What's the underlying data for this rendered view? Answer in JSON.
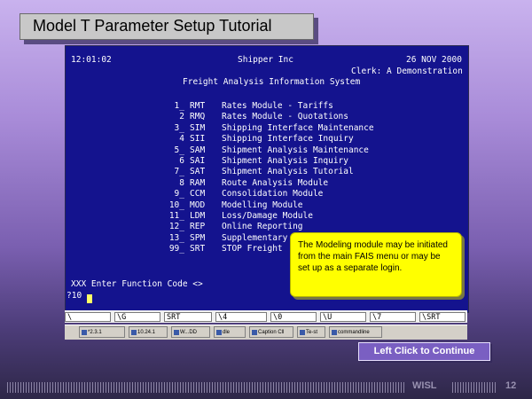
{
  "slide": {
    "title": "Model T Parameter Setup Tutorial",
    "continue_label": "Left Click to Continue",
    "footer_org": "WISL",
    "page_number": "12"
  },
  "terminal": {
    "time": "12:01:02",
    "company": "Shipper Inc",
    "date": "26 NOV 2000",
    "clerk": "Clerk: A Demonstration",
    "system_name": "Freight Analysis Information System",
    "menu": [
      {
        "num": "1_",
        "code": "RMT",
        "desc": "Rates Module - Tariffs"
      },
      {
        "num": "2",
        "code": "RMQ",
        "desc": "Rates Module - Quotations"
      },
      {
        "num": "3_",
        "code": "SIM",
        "desc": "Shipping Interface Maintenance"
      },
      {
        "num": "4",
        "code": "SII",
        "desc": "Shipping Interface Inquiry"
      },
      {
        "num": "5_",
        "code": "SAM",
        "desc": "Shipment Analysis Maintenance"
      },
      {
        "num": "6",
        "code": "SAI",
        "desc": "Shipment Analysis Inquiry"
      },
      {
        "num": "7_",
        "code": "SAT",
        "desc": "Shipment Analysis Tutorial"
      },
      {
        "num": "8",
        "code": "RAM",
        "desc": "Route Analysis Module"
      },
      {
        "num": "9_",
        "code": "CCM",
        "desc": "Consolidation Module"
      },
      {
        "num": "10_",
        "code": "MOD",
        "desc": "Modelling Module"
      },
      {
        "num": "11_",
        "code": "LDM",
        "desc": "Loss/Damage Module"
      },
      {
        "num": "12_",
        "code": "REP",
        "desc": "Online Reporting"
      },
      {
        "num": "13_",
        "code": "SPM",
        "desc": "Supplementary"
      },
      {
        "num": "99_",
        "code": "SRT",
        "desc": "STOP Freight"
      }
    ],
    "prompt": "XXX Enter Function Code <>",
    "input_value": "?10",
    "function_keys": [
      "\\",
      "\\G",
      "SRT",
      "\\4",
      "\\0",
      "\\U",
      "\\7",
      "\\SRT"
    ]
  },
  "callout": {
    "text": "The Modeling module may be initiated from the main FAIS menu or may be set up as a separate login."
  },
  "taskbar": {
    "items": [
      "*2.3.1",
      "10.24.1",
      "W...DD",
      "dle",
      "Caption Cll",
      "Te-st",
      "commandline"
    ]
  }
}
